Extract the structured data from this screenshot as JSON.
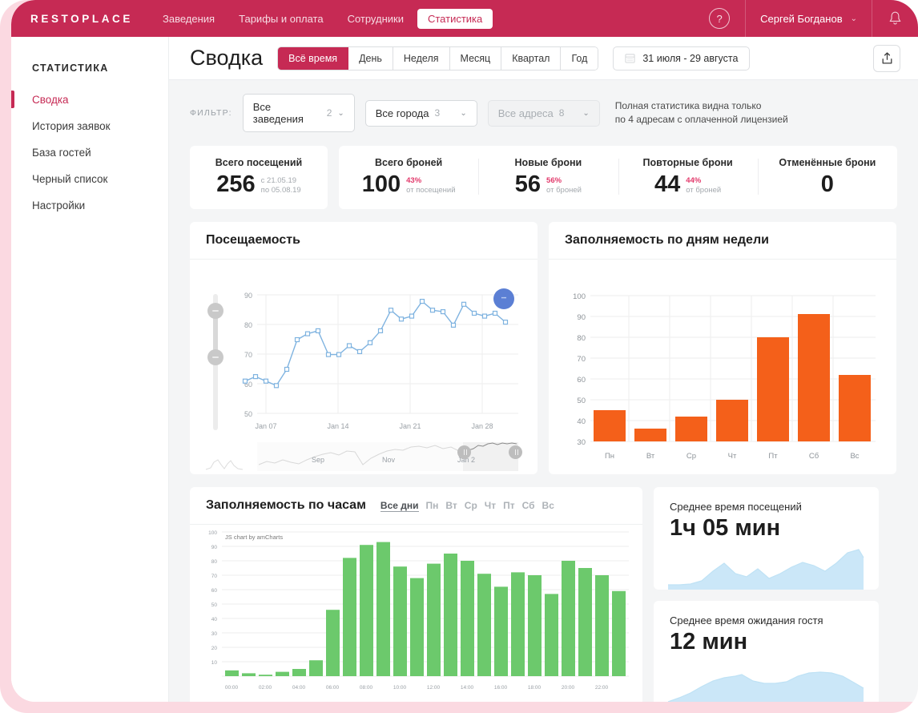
{
  "brand": "RESTOPLACE",
  "topnav": {
    "items": [
      {
        "label": "Заведения",
        "active": false
      },
      {
        "label": "Тарифы и оплата",
        "active": false
      },
      {
        "label": "Сотрудники",
        "active": false
      },
      {
        "label": "Статистика",
        "active": true
      }
    ],
    "help_glyph": "?",
    "user_name": "Сергей Богданов",
    "chevron": "⌄"
  },
  "sidebar": {
    "title": "СТАТИСТИКА",
    "items": [
      {
        "label": "Сводка",
        "active": true
      },
      {
        "label": "История заявок",
        "active": false
      },
      {
        "label": "База гостей",
        "active": false
      },
      {
        "label": "Черный список",
        "active": false
      },
      {
        "label": "Настройки",
        "active": false
      }
    ]
  },
  "header": {
    "page_title": "Сводка",
    "period_tabs": [
      {
        "label": "Всё время",
        "active": true
      },
      {
        "label": "День",
        "active": false
      },
      {
        "label": "Неделя",
        "active": false
      },
      {
        "label": "Месяц",
        "active": false
      },
      {
        "label": "Квартал",
        "active": false
      },
      {
        "label": "Год",
        "active": false
      }
    ],
    "date_range": "31 июля - 29 августа"
  },
  "filter": {
    "label": "ФИЛЬТР:",
    "selects": [
      {
        "label": "Все заведения",
        "count": "2",
        "disabled": false
      },
      {
        "label": "Все города",
        "count": "3",
        "disabled": false
      },
      {
        "label": "Все адреса",
        "count": "8",
        "disabled": true
      }
    ],
    "note_line1": "Полная статистика видна только",
    "note_line2": "по 4 адресам с оплаченной лицензией"
  },
  "kpis": [
    {
      "label": "Всего посещений",
      "value": "256",
      "pct": "",
      "note1": "с 21.05.19",
      "note2": "по 05.08.19"
    },
    {
      "label": "Всего броней",
      "value": "100",
      "pct": "43%",
      "note1": "от посещений",
      "note2": ""
    },
    {
      "label": "Новые брони",
      "value": "56",
      "pct": "56%",
      "note1": "от броней",
      "note2": ""
    },
    {
      "label": "Повторные брони",
      "value": "44",
      "pct": "44%",
      "note1": "от броней",
      "note2": ""
    },
    {
      "label": "Отменённые брони",
      "value": "0",
      "pct": "",
      "note1": "",
      "note2": ""
    }
  ],
  "cards": {
    "attendance_title": "Посещаемость",
    "weekday_title": "Заполняемость по дням недели",
    "hourly_title": "Заполняемость по часам",
    "hourly_daytabs": [
      {
        "label": "Все дни",
        "active": true
      },
      {
        "label": "Пн",
        "active": false
      },
      {
        "label": "Вт",
        "active": false
      },
      {
        "label": "Ср",
        "active": false
      },
      {
        "label": "Чт",
        "active": false
      },
      {
        "label": "Пт",
        "active": false
      },
      {
        "label": "Сб",
        "active": false
      },
      {
        "label": "Вс",
        "active": false
      }
    ],
    "watermark": "JS chart by amCharts",
    "avg_visit": {
      "label": "Среднее время посещений",
      "value": "1ч 05 мин"
    },
    "avg_wait": {
      "label": "Среднее время ожидания гостя",
      "value": "12 мин"
    }
  },
  "chart_data": [
    {
      "type": "line",
      "title": "Посещаемость",
      "xlabel": "",
      "ylabel": "",
      "ylim": [
        50,
        90
      ],
      "yticks": [
        50,
        60,
        70,
        80,
        90
      ],
      "xtick_labels": [
        "Jan 07",
        "Jan 14",
        "Jan 21",
        "Jan 28"
      ],
      "xtick_positions": [
        2,
        9,
        16,
        23
      ],
      "grid": true,
      "legend": "none",
      "series": [
        {
          "name": "Посещаемость",
          "color": "#7fb3e0",
          "values": [
            61,
            62.5,
            61,
            59.5,
            65,
            75,
            77,
            78,
            70,
            70,
            73,
            71,
            74,
            78,
            85,
            82,
            83,
            88,
            85,
            84.5,
            80,
            87,
            84,
            83,
            84,
            81
          ]
        }
      ],
      "navigator": {
        "labels": [
          "Sep",
          "Nov",
          "Jan 2"
        ],
        "selection_start": 0.79,
        "selection_end": 1.0
      },
      "vertical_slider": {
        "min": 50,
        "max": 90,
        "handle_high": 87,
        "handle_low": 70
      }
    },
    {
      "type": "bar",
      "title": "Заполняемость по дням недели",
      "categories": [
        "Пн",
        "Вт",
        "Ср",
        "Чт",
        "Пт",
        "Сб",
        "Вс"
      ],
      "values": [
        45,
        36,
        42,
        50,
        80,
        91,
        62
      ],
      "color": "#f4601a",
      "ylim": [
        30,
        100
      ],
      "yticks": [
        30,
        40,
        50,
        60,
        70,
        80,
        90,
        100
      ],
      "xlabel": "",
      "ylabel": "",
      "grid": true,
      "legend": "none"
    },
    {
      "type": "bar",
      "title": "Заполняемость по часам",
      "categories": [
        "00:00",
        "01:00",
        "02:00",
        "03:00",
        "04:00",
        "05:00",
        "06:00",
        "07:00",
        "08:00",
        "09:00",
        "10:00",
        "11:00",
        "12:00",
        "13:00",
        "14:00",
        "15:00",
        "16:00",
        "17:00",
        "18:00",
        "19:00",
        "20:00",
        "21:00",
        "22:00",
        "23:00"
      ],
      "tick_labels": [
        "00:00",
        "02:00",
        "04:00",
        "06:00",
        "08:00",
        "10:00",
        "12:00",
        "14:00",
        "16:00",
        "18:00",
        "20:00",
        "22:00"
      ],
      "values": [
        4,
        2,
        1,
        3,
        5,
        11,
        46,
        82,
        91,
        93,
        76,
        68,
        78,
        85,
        80,
        71,
        62,
        72,
        70,
        57,
        79,
        74,
        70,
        59
      ],
      "color": "#6cc96c",
      "ylim": [
        0,
        100
      ],
      "yticks": [
        10,
        20,
        30,
        40,
        50,
        60,
        70,
        80,
        90,
        100
      ],
      "xlabel": "",
      "ylabel": "",
      "grid": true,
      "legend": "none"
    },
    {
      "type": "area",
      "title": "Среднее время посещений",
      "color": "#bfe2f5",
      "values": [
        8,
        8,
        9,
        14,
        30,
        44,
        28,
        24,
        36,
        20,
        27,
        38,
        46,
        40,
        30,
        44,
        62,
        70,
        52
      ],
      "ylim": [
        0,
        80
      ],
      "grid": false,
      "legend": "none"
    },
    {
      "type": "area",
      "title": "Среднее время ожидания гостя",
      "color": "#bfe2f5",
      "values": [
        4,
        10,
        18,
        30,
        40,
        46,
        48,
        40,
        33,
        34,
        34,
        42,
        48,
        50,
        50,
        48,
        42,
        33,
        24,
        20,
        18
      ],
      "ylim": [
        0,
        60
      ],
      "grid": false,
      "legend": "none"
    }
  ]
}
